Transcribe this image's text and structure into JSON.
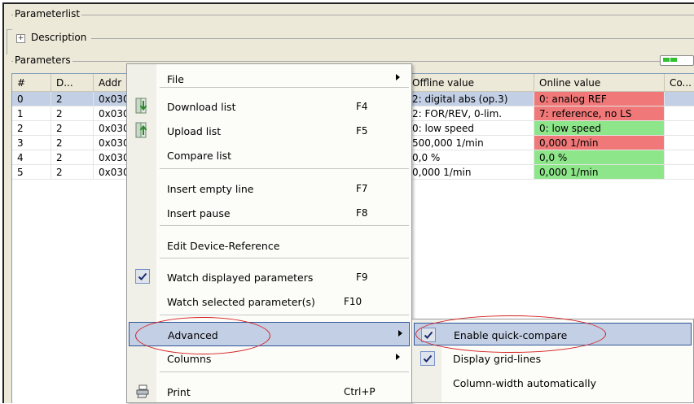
{
  "panel": {
    "title": "Parameterlist",
    "description_label": "Description",
    "parameters_label": "Parameters",
    "expander_glyph": "+"
  },
  "table": {
    "columns": [
      "#",
      "D...",
      "Addr",
      "Offline value",
      "Online value",
      "Co..."
    ],
    "rows": [
      {
        "num": "0",
        "d": "2",
        "addr": "0x030",
        "offline": "2: digital abs (op.3)",
        "online": "0: analog REF",
        "state": "red",
        "selected": true
      },
      {
        "num": "1",
        "d": "2",
        "addr": "0x030",
        "offline": "2: FOR/REV, 0-lim.",
        "online": "7: reference, no LS",
        "state": "red",
        "selected": false
      },
      {
        "num": "2",
        "d": "2",
        "addr": "0x030",
        "offline": "0: low speed",
        "online": "0: low speed",
        "state": "green",
        "selected": false
      },
      {
        "num": "3",
        "d": "2",
        "addr": "0x030",
        "offline": "500,000 1/min",
        "online": "0,000 1/min",
        "state": "red",
        "selected": false
      },
      {
        "num": "4",
        "d": "2",
        "addr": "0x030",
        "offline": "0,0 %",
        "online": "0,0 %",
        "state": "green",
        "selected": false
      },
      {
        "num": "5",
        "d": "2",
        "addr": "0x030",
        "offline": "0,000 1/min",
        "online": "0,000 1/min",
        "state": "green",
        "selected": false
      }
    ]
  },
  "context_menu": {
    "items": [
      {
        "label": "File",
        "shortcut": "",
        "submenu": true
      },
      {
        "label": "Download list",
        "shortcut": "F4",
        "icon": "download-icon"
      },
      {
        "label": "Upload list",
        "shortcut": "F5",
        "icon": "upload-icon"
      },
      {
        "label": "Compare list",
        "shortcut": ""
      },
      {
        "label": "Insert empty line",
        "shortcut": "F7"
      },
      {
        "label": "Insert pause",
        "shortcut": "F8"
      },
      {
        "label": "Edit Device-Reference",
        "shortcut": ""
      },
      {
        "label": "Watch displayed parameters",
        "shortcut": "F9",
        "checked": true
      },
      {
        "label": "Watch selected parameter(s)",
        "shortcut": "F10"
      },
      {
        "label": "Advanced",
        "shortcut": "",
        "submenu": true,
        "highlighted": true
      },
      {
        "label": "Columns",
        "shortcut": "",
        "submenu": true
      },
      {
        "label": "Print",
        "shortcut": "Ctrl+P",
        "icon": "printer-icon"
      }
    ]
  },
  "advanced_submenu": {
    "items": [
      {
        "label": "Enable quick-compare",
        "checked": true,
        "highlighted": true
      },
      {
        "label": "Display grid-lines",
        "checked": true
      },
      {
        "label": "Column-width automatically",
        "checked": false
      }
    ]
  },
  "glyphs": {
    "check": "✓"
  },
  "colors": {
    "highlight": "#c3cfe4",
    "mismatch": "#f07878",
    "match": "#8ee68a",
    "annotation": "#d42020"
  }
}
